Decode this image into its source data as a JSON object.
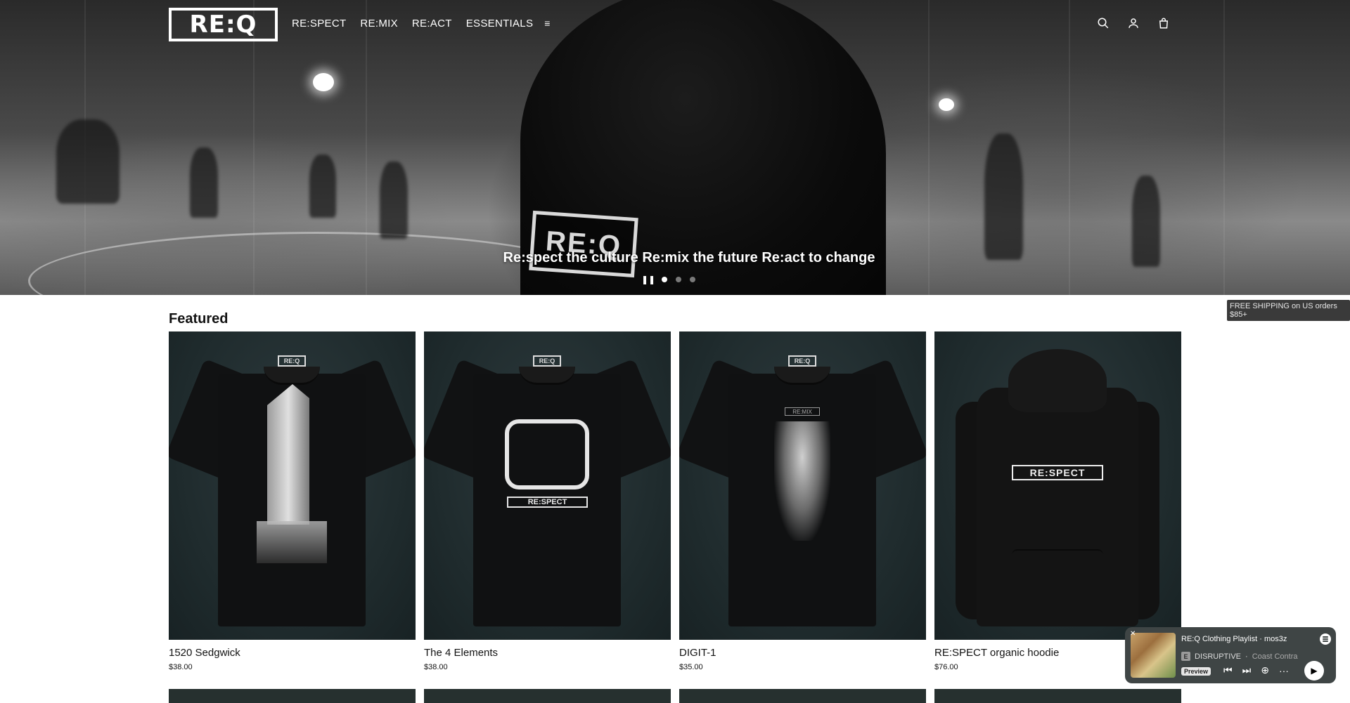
{
  "header": {
    "logo_text": "RE:Q",
    "nav": [
      "RE:SPECT",
      "RE:MIX",
      "RE:ACT",
      "ESSENTIALS"
    ],
    "menu_icon": "≡"
  },
  "hero": {
    "tagline": "Re:spect the culture Re:mix the future Re:act to change",
    "hood_logo": "RE:Q"
  },
  "announcement": "FREE SHIPPING on US orders $85+",
  "featured": {
    "title": "Featured",
    "products": [
      {
        "title": "1520 Sedgwick",
        "price": "$38.00"
      },
      {
        "title": "The 4 Elements",
        "price": "$38.00"
      },
      {
        "title": "DIGIT-1",
        "price": "$35.00"
      },
      {
        "title": "RE:SPECT organic hoodie",
        "price": "$76.00"
      }
    ],
    "tag_label": "RE:Q",
    "hoodie_print": "RE:SPECT",
    "elements_print": "RE:SPECT",
    "digit_print": "RE:MIX"
  },
  "player": {
    "playlist": "RE:Q Clothing Playlist",
    "owner": "mos3z",
    "explicit": "E",
    "track": "DISRUPTIVE",
    "artist": "Coast Contra",
    "preview": "Preview"
  }
}
